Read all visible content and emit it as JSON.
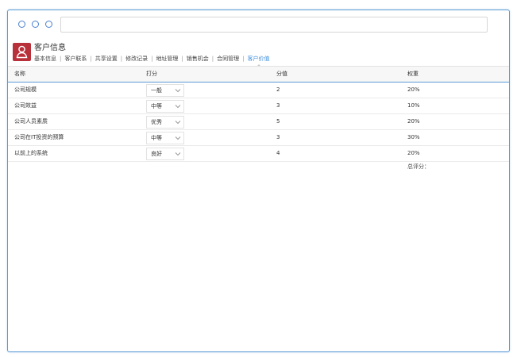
{
  "header": {
    "title": "客户信息"
  },
  "tabs": [
    {
      "label": "基本信息",
      "active": false
    },
    {
      "label": "客户联系",
      "active": false
    },
    {
      "label": "共享设置",
      "active": false
    },
    {
      "label": "修改记录",
      "active": false
    },
    {
      "label": "地址管理",
      "active": false
    },
    {
      "label": "销售机会",
      "active": false
    },
    {
      "label": "合同管理",
      "active": false
    },
    {
      "label": "客户价值",
      "active": true
    }
  ],
  "table": {
    "headers": [
      "名称",
      "打分",
      "分值",
      "权重"
    ],
    "rows": [
      {
        "name": "公司规模",
        "rating": "一般",
        "score": "2",
        "weight": "20%"
      },
      {
        "name": "公司效益",
        "rating": "中等",
        "score": "3",
        "weight": "10%"
      },
      {
        "name": "公司人员素质",
        "rating": "优秀",
        "score": "5",
        "weight": "20%"
      },
      {
        "name": "公司在IT投资的预算",
        "rating": "中等",
        "score": "3",
        "weight": "30%"
      },
      {
        "name": "以前上的系统",
        "rating": "良好",
        "score": "4",
        "weight": "20%"
      }
    ],
    "total_label": "总评分："
  },
  "colors": {
    "accent": "#3d8ee0",
    "window_border": "#5b9bd5",
    "avatar_bg": "#b8303a"
  },
  "icons": {
    "window_dots": [
      "window-dot-icon",
      "window-dot-icon",
      "window-dot-icon"
    ],
    "avatar": "user-icon",
    "select_arrow": "chevron-down-icon"
  }
}
